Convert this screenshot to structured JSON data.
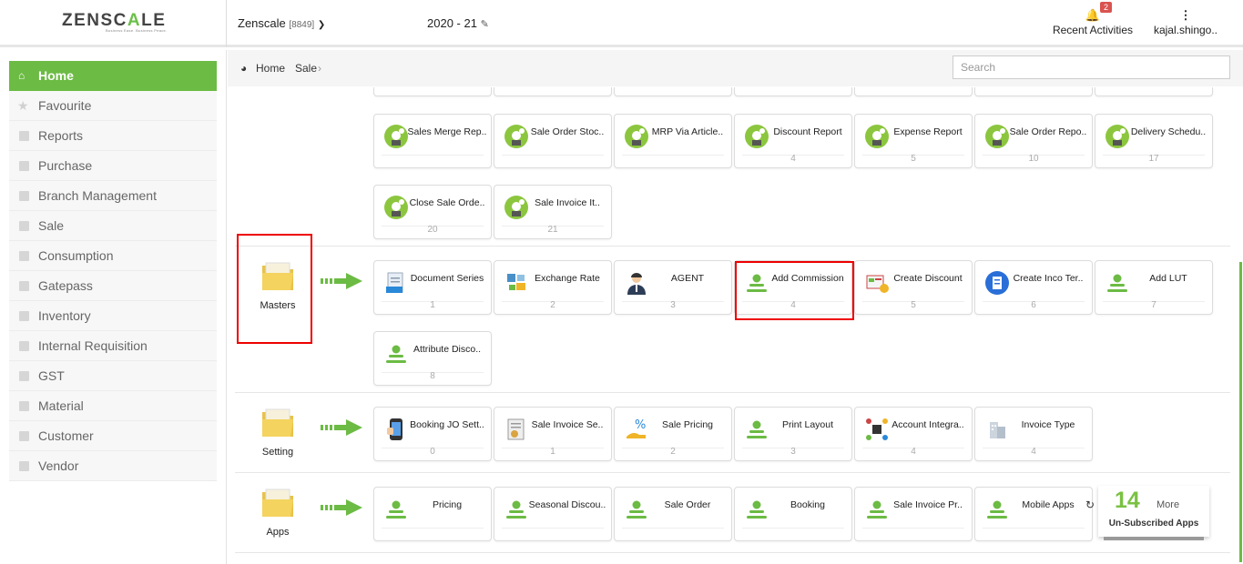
{
  "app": {
    "logo": "ZENSCALE",
    "tagline": "Business Ease. Business Peace.",
    "company": "Zenscale",
    "company_id": "[8849]",
    "year": "2020 - 21"
  },
  "header": {
    "recent_label": "Recent Activities",
    "badge": "2",
    "user": "kajal.shingo.."
  },
  "sidebar": {
    "items": [
      {
        "label": "Home",
        "icon": "home-icon"
      },
      {
        "label": "Favourite",
        "icon": "star-icon"
      },
      {
        "label": "Reports",
        "icon": "file-icon"
      },
      {
        "label": "Purchase",
        "icon": "folder-icon"
      },
      {
        "label": "Branch Management",
        "icon": "folder-icon"
      },
      {
        "label": "Sale",
        "icon": "folder-icon"
      },
      {
        "label": "Consumption",
        "icon": "folder-icon"
      },
      {
        "label": "Gatepass",
        "icon": "folder-icon"
      },
      {
        "label": "Inventory",
        "icon": "folder-icon"
      },
      {
        "label": "Internal Requisition",
        "icon": "folder-icon"
      },
      {
        "label": "GST",
        "icon": "folder-icon"
      },
      {
        "label": "Material",
        "icon": "folder-icon"
      },
      {
        "label": "Customer",
        "icon": "folder-icon"
      },
      {
        "label": "Vendor",
        "icon": "folder-icon"
      }
    ]
  },
  "breadcrumb": {
    "home": "Home",
    "current": "Sale"
  },
  "search": {
    "placeholder": "Search"
  },
  "reports": [
    {
      "label": "Sales Merge Rep..",
      "num": ""
    },
    {
      "label": "Sale Order Stoc..",
      "num": ""
    },
    {
      "label": "MRP Via Article..",
      "num": ""
    },
    {
      "label": "Discount Report",
      "num": "4"
    },
    {
      "label": "Expense Report",
      "num": "5"
    },
    {
      "label": "Sale Order Repo..",
      "num": "10"
    },
    {
      "label": "Delivery Schedu..",
      "num": "17"
    },
    {
      "label": "Close Sale Orde..",
      "num": "20"
    },
    {
      "label": "Sale Invoice It..",
      "num": "21"
    }
  ],
  "groups": [
    {
      "name": "Masters",
      "tiles": [
        {
          "label": "Document Series",
          "num": "1",
          "icon": "doc-icon"
        },
        {
          "label": "Exchange Rate",
          "num": "2",
          "icon": "exchange-icon"
        },
        {
          "label": "AGENT",
          "num": "3",
          "icon": "agent-icon"
        },
        {
          "label": "Add Commission",
          "num": "4",
          "icon": "person-icon"
        },
        {
          "label": "Create Discount",
          "num": "5",
          "icon": "discount-icon"
        },
        {
          "label": "Create Inco Ter..",
          "num": "6",
          "icon": "inco-icon"
        },
        {
          "label": "Add LUT",
          "num": "7",
          "icon": "person-icon"
        },
        {
          "label": "Attribute Disco..",
          "num": "8",
          "icon": "person-icon"
        }
      ]
    },
    {
      "name": "Setting",
      "tiles": [
        {
          "label": "Booking JO Sett..",
          "num": "0",
          "icon": "phone-icon"
        },
        {
          "label": "Sale Invoice Se..",
          "num": "1",
          "icon": "invoice-icon"
        },
        {
          "label": "Sale Pricing",
          "num": "2",
          "icon": "pricing-icon"
        },
        {
          "label": "Print Layout",
          "num": "3",
          "icon": "person-icon"
        },
        {
          "label": "Account Integra..",
          "num": "4",
          "icon": "integration-icon"
        },
        {
          "label": "Invoice Type",
          "num": "4",
          "icon": "building-icon"
        }
      ]
    },
    {
      "name": "Apps",
      "tiles": [
        {
          "label": "Pricing",
          "num": "",
          "icon": "person-icon"
        },
        {
          "label": "Seasonal Discou..",
          "num": "",
          "icon": "person-icon"
        },
        {
          "label": "Sale Order",
          "num": "",
          "icon": "person-icon"
        },
        {
          "label": "Booking",
          "num": "",
          "icon": "person-icon"
        },
        {
          "label": "Sale Invoice Pr..",
          "num": "",
          "icon": "person-icon"
        },
        {
          "label": "Mobile Apps",
          "num": "",
          "icon": "person-icon"
        }
      ]
    }
  ],
  "more": {
    "count": "14",
    "label": "More",
    "sub": "Un-Subscribed Apps"
  },
  "colors": {
    "accent": "#6cbb44",
    "highlight": "#e00000",
    "badge": "#d9534f"
  }
}
